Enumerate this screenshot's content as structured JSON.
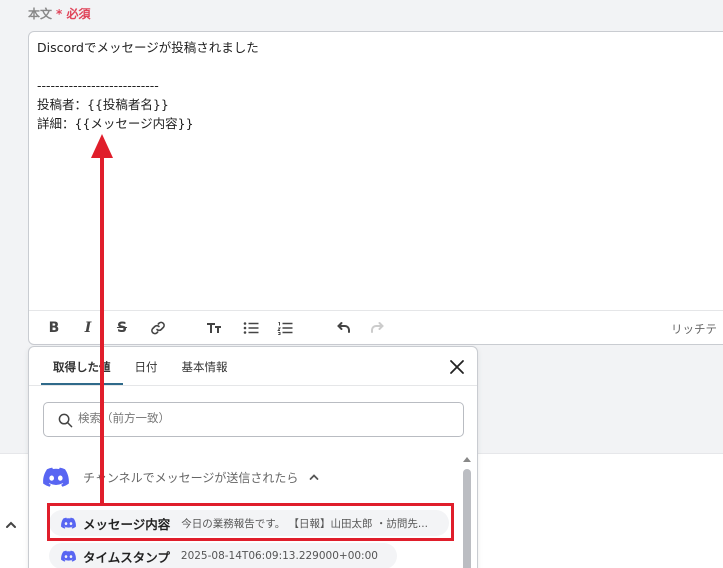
{
  "field": {
    "label": "本文",
    "required": "必須"
  },
  "editor": {
    "lines": [
      "Discordでメッセージが投稿されました",
      "",
      "---------------------------",
      "投稿者：{{投稿者名}}",
      "詳細：{{メッセージ内容}}"
    ],
    "toolbar": {
      "bold": "B",
      "italic": "I",
      "strike": "S",
      "rich_label": "リッチテ"
    }
  },
  "popup": {
    "tabs": [
      {
        "label": "取得した値"
      },
      {
        "label": "日付"
      },
      {
        "label": "基本情報"
      }
    ],
    "search": {
      "placeholder": "検索（前方一致）"
    },
    "group": {
      "label": "チャンネルでメッセージが送信されたら"
    },
    "items": [
      {
        "name": "メッセージ内容",
        "value": "今日の業務報告です。 【日報】山田太郎 ・訪問先..."
      },
      {
        "name": "タイムスタンプ",
        "value": "2025-08-14T06:09:13.229000+00:00"
      }
    ]
  },
  "colors": {
    "required": "#e0445a",
    "discord": "#5865f2",
    "highlight": "#e01e2b",
    "tab_active": "#2f6a8a"
  }
}
